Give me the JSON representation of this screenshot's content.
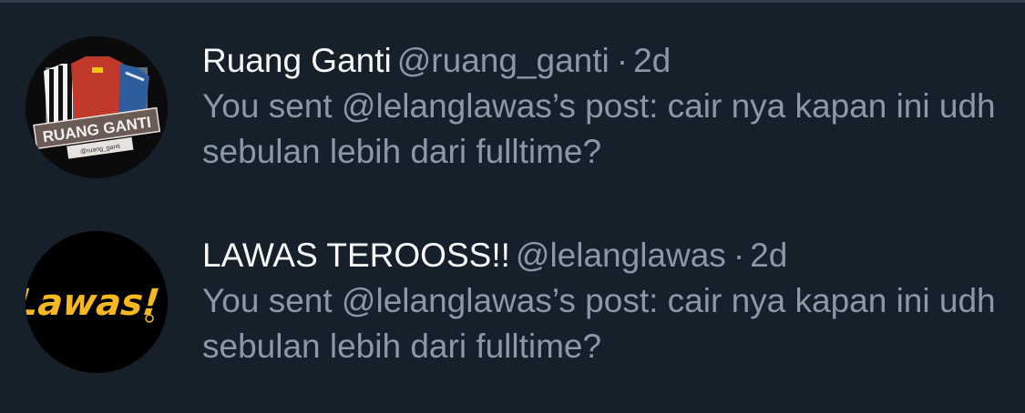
{
  "conversations": [
    {
      "display_name": "Ruang Ganti",
      "handle": "@ruang_ganti",
      "separator": "·",
      "time": "2d",
      "preview": "You sent @lelanglawas’s post: cair nya kapan ini udh sebulan lebih dari fulltime?",
      "avatar_logo_text": "RUANG GANTI",
      "avatar_small_text": "@ruang_ganti"
    },
    {
      "display_name": "LAWAS TEROOSS!!",
      "handle": "@lelanglawas",
      "separator": "·",
      "time": "2d",
      "preview": "You sent @lelanglawas’s post: cair nya kapan ini udh sebulan lebih dari fulltime?",
      "avatar_logo_text": "Lawas!"
    }
  ],
  "colors": {
    "background": "#15202b",
    "primary_text": "#f7f9f9",
    "secondary_text": "#8b98a5",
    "lawas_logo": "#f5b820"
  }
}
